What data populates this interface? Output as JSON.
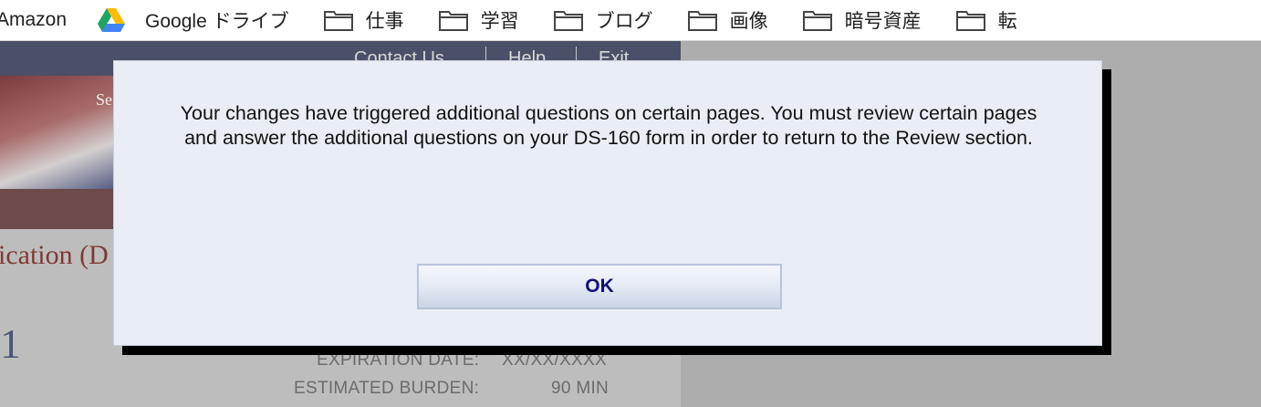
{
  "bookmarks": [
    {
      "label": "Amazon",
      "icon": "none"
    },
    {
      "label": "Google ドライブ",
      "icon": "google-drive-icon"
    },
    {
      "label": "仕事",
      "icon": "folder-icon"
    },
    {
      "label": "学習",
      "icon": "folder-icon"
    },
    {
      "label": "ブログ",
      "icon": "folder-icon"
    },
    {
      "label": "画像",
      "icon": "folder-icon"
    },
    {
      "label": "暗号資産",
      "icon": "folder-icon"
    },
    {
      "label": "転",
      "icon": "folder-icon"
    }
  ],
  "site": {
    "nav": {
      "contact": "Contact Us",
      "help": "Help",
      "exit": "Exit"
    },
    "banner_text": "Se",
    "title_fragment": "ication (D",
    "big_number": "1",
    "expiration_label": "EXPIRATION DATE:",
    "expiration_value": "XX/XX/XXXX",
    "burden_label": "ESTIMATED BURDEN:",
    "burden_value": "90 MIN"
  },
  "dialog": {
    "message": "Your changes have triggered additional questions on certain pages. You must review certain pages and answer the additional questions on your DS-160 form in order to return to the Review section.",
    "ok_label": "OK"
  },
  "colors": {
    "dialog_bg": "#e9eef6",
    "ok_text": "#10107a",
    "overlay": "#adadad"
  }
}
